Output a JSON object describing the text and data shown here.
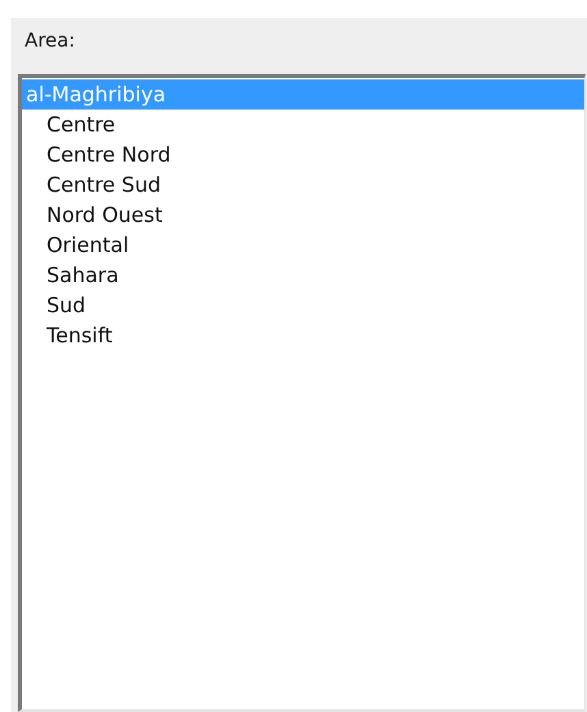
{
  "label": "Area:",
  "tree": [
    {
      "label": "al-Maghribiya",
      "selected": true,
      "children": [
        {
          "label": "Centre",
          "selected": false
        },
        {
          "label": "Centre Nord",
          "selected": false
        },
        {
          "label": "Centre Sud",
          "selected": false
        },
        {
          "label": "Nord Ouest",
          "selected": false
        },
        {
          "label": "Oriental",
          "selected": false
        },
        {
          "label": "Sahara",
          "selected": false
        },
        {
          "label": "Sud",
          "selected": false
        },
        {
          "label": "Tensift",
          "selected": false
        }
      ]
    }
  ]
}
